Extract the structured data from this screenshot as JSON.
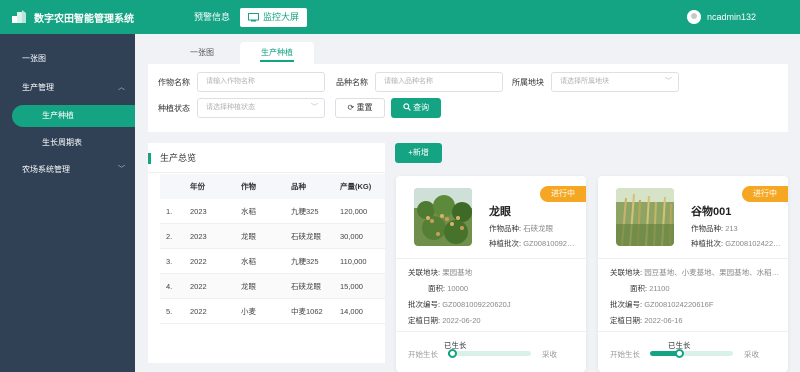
{
  "header": {
    "app_title": "数字农田智能管理系统",
    "nav_warning": "预警信息",
    "nav_monitor": "监控大屏",
    "username": "ncadmin132"
  },
  "sidebar": {
    "items": [
      {
        "label": "一张图"
      },
      {
        "label": "生产管理"
      },
      {
        "label": "生产种植"
      },
      {
        "label": "生长周期表"
      },
      {
        "label": "农场系统管理"
      }
    ]
  },
  "tabs": [
    {
      "label": "一张图"
    },
    {
      "label": "生产种植"
    }
  ],
  "filter": {
    "crop_label": "作物名称",
    "crop_placeholder": "请输入作物名称",
    "variety_label": "品种名称",
    "variety_placeholder": "请输入品种名称",
    "base_label": "所属地块",
    "base_placeholder": "请选择所属地块",
    "status_label": "种植状态",
    "status_placeholder": "请选择种植状态",
    "reset_label": "重置",
    "query_label": "查询"
  },
  "summary": {
    "title": "生产总览",
    "headers": [
      "年份",
      "作物",
      "品种",
      "产量(KG)"
    ],
    "rows": [
      [
        "1.",
        "2023",
        "水稻",
        "九粳325",
        "120,000"
      ],
      [
        "2.",
        "2023",
        "龙眼",
        "石硖龙眼",
        "30,000"
      ],
      [
        "3.",
        "2022",
        "水稻",
        "九粳325",
        "110,000"
      ],
      [
        "4.",
        "2022",
        "龙眼",
        "石硖龙眼",
        "15,000"
      ],
      [
        "5.",
        "2022",
        "小麦",
        "中麦1062",
        "14,000"
      ]
    ]
  },
  "add_label": "+新增",
  "cards": [
    {
      "status": "进行中",
      "name": "龙眼",
      "variety_label": "作物品种:",
      "variety": "石硖龙眼",
      "batch_label": "种植批次:",
      "batch": "GZ00810092…",
      "base_label": "关联地块:",
      "base": "果园基地",
      "area_label": "面积:",
      "area": "10000",
      "batch_no_label": "批次编号:",
      "batch_no": "GZ0081009220620J",
      "plant_date_label": "定植日期:",
      "plant_date": "2022-06-20",
      "stage_start": "开始生长",
      "stage_current": "已生长",
      "stage_end": "采收",
      "progress": 0.05
    },
    {
      "status": "进行中",
      "name": "谷物001",
      "variety_label": "作物品种:",
      "variety": "213",
      "batch_label": "种植批次:",
      "batch": "GZ008102422…",
      "base_label": "关联地块:",
      "base": "园豆基地、小麦基地、果园基地、水稻…",
      "area_label": "面积:",
      "area": "21100",
      "batch_no_label": "批次编号:",
      "batch_no": "GZ0081024220616F",
      "plant_date_label": "定植日期:",
      "plant_date": "2022-06-16",
      "stage_start": "开始生长",
      "stage_current": "已生长",
      "stage_end": "采收",
      "progress": 0.35
    }
  ],
  "colors": {
    "primary": "#15a483",
    "sidebar": "#304156",
    "badge": "#f5a623"
  }
}
